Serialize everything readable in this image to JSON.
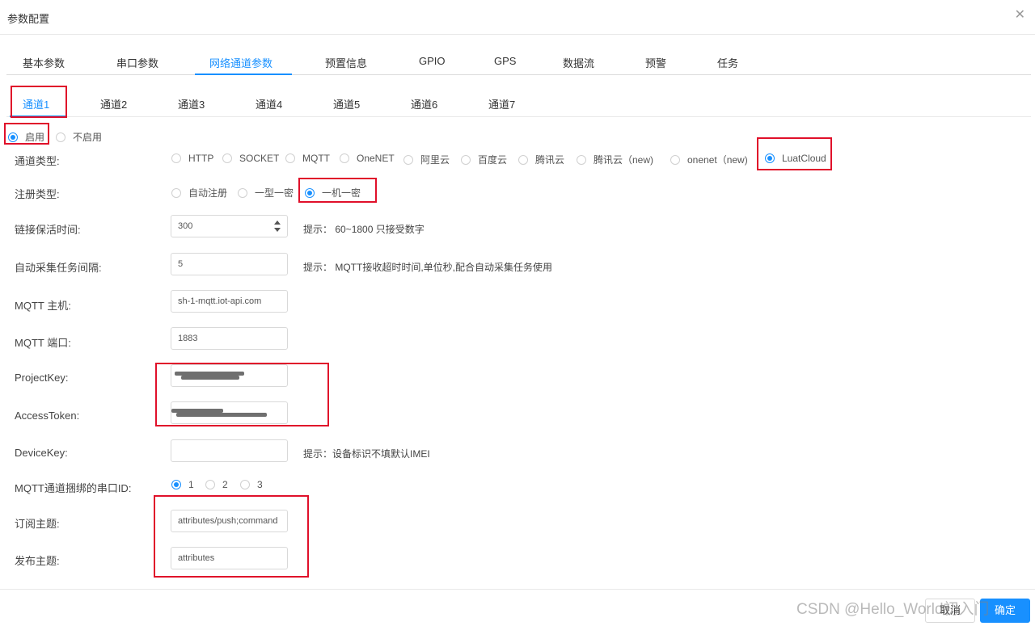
{
  "dialog": {
    "title": "参数配置",
    "close_icon": "close-icon"
  },
  "main_tabs": [
    "基本参数",
    "串口参数",
    "网络通道参数",
    "预置信息",
    "GPIO",
    "GPS",
    "数据流",
    "预警",
    "任务"
  ],
  "main_tab_active": "网络通道参数",
  "channel_tabs": [
    "通道1",
    "通道2",
    "通道3",
    "通道4",
    "通道5",
    "通道6",
    "通道7"
  ],
  "channel_tab_active": "通道1",
  "enable": {
    "on": "启用",
    "off": "不启用",
    "selected": "启用"
  },
  "channel_type": {
    "label": "通道类型:",
    "options": [
      "HTTP",
      "SOCKET",
      "MQTT",
      "OneNET",
      "阿里云",
      "百度云",
      "腾讯云",
      "腾讯云（new)",
      "onenet（new)",
      "LuatCloud"
    ],
    "selected": "LuatCloud"
  },
  "register_type": {
    "label": "注册类型:",
    "options": [
      "自动注册",
      "一型一密",
      "一机一密"
    ],
    "selected": "一机一密"
  },
  "keepalive": {
    "label": "链接保活时间:",
    "value": "300",
    "hint": "提示： 60~1800 只接受数字"
  },
  "auto_collect": {
    "label": "自动采集任务间隔:",
    "value": "5",
    "hint": "提示： MQTT接收超时时间,单位秒,配合自动采集任务使用"
  },
  "mqtt_host": {
    "label": "MQTT 主机:",
    "value": "sh-1-mqtt.iot-api.com"
  },
  "mqtt_port": {
    "label": "MQTT 端口:",
    "value": "1883"
  },
  "project_key": {
    "label": "ProjectKey:"
  },
  "access_token": {
    "label": "AccessToken:"
  },
  "device_key": {
    "label": "DeviceKey:",
    "value": "",
    "hint": "提示：设备标识不填默认IMEI"
  },
  "serial_binding": {
    "label": "MQTT通道捆绑的串口ID:",
    "options": [
      "1",
      "2",
      "3"
    ],
    "selected": "1"
  },
  "subscribe_topic": {
    "label": "订阅主题:",
    "value": "attributes/push;command"
  },
  "publish_topic": {
    "label": "发布主题:",
    "value": "attributes"
  },
  "footer": {
    "cancel": "取消",
    "ok": "确定"
  },
  "watermark": "CSDN @Hello_World初入门",
  "colors": {
    "accent": "#1890ff",
    "highlight_box": "#e0102a"
  }
}
